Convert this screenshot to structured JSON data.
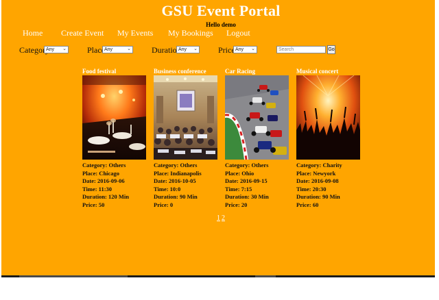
{
  "header": {
    "title": "GSU Event Portal",
    "greeting": "Hello demo"
  },
  "nav": [
    {
      "label": "Home"
    },
    {
      "label": "Create Event"
    },
    {
      "label": "My Events"
    },
    {
      "label": "My Bookings"
    },
    {
      "label": "Logout"
    }
  ],
  "filters": {
    "category": {
      "label": "Category",
      "value": "Any"
    },
    "place": {
      "label": "Place",
      "value": "Any"
    },
    "duration": {
      "label": "Duration",
      "value": "Any"
    },
    "price": {
      "label": "Price",
      "value": "Any"
    },
    "search": {
      "placeholder": "Search",
      "button": "Go"
    }
  },
  "events": [
    {
      "title": "Food festival",
      "category": "Category: Others",
      "place": "Place: Chicago",
      "date": "Date: 2016-09-06",
      "time": "Time: 11:30",
      "duration": "Duration: 120 Min",
      "price": "Price: 50",
      "image": "banquet-photo"
    },
    {
      "title": "Business conference",
      "category": "Category: Others",
      "place": "Place: Indianapolis",
      "date": "Date: 2016-10-05",
      "time": "Time: 10:0",
      "duration": "Duration: 90 Min",
      "price": "Price: 0",
      "image": "conference-hall-photo"
    },
    {
      "title": "Car Racing",
      "category": "Category: Others",
      "place": "Place: Ohio",
      "date": "Date: 2016-09-15",
      "time": "Time: 7:15",
      "duration": "Duration: 30 Min",
      "price": "Price: 20",
      "image": "race-cars-photo"
    },
    {
      "title": "Musical concert",
      "category": "Category: Charity",
      "place": "Place: Newyork",
      "date": "Date: 2016-09-08",
      "time": "Time: 20:30",
      "duration": "Duration: 90 Min",
      "price": "Price: 60",
      "image": "concert-crowd-photo"
    }
  ],
  "pagination": {
    "pages": [
      "1",
      "2"
    ]
  },
  "colors": {
    "background": "#FFA500",
    "text_light": "#FFFFFF"
  }
}
